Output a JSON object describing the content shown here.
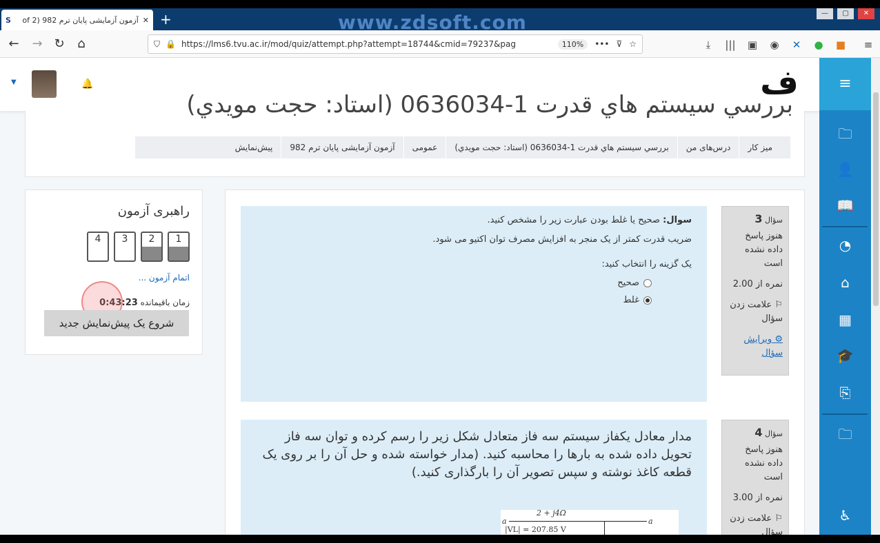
{
  "browser": {
    "tab_title": "آزمون آزمایشی پایان ترم 982 (2 of",
    "watermark": "www.zdsoft.com",
    "url": "https://lms6.tvu.ac.ir/mod/quiz/attempt.php?attempt=18744&cmid=79237&pag",
    "zoom": "110%"
  },
  "header": {
    "course_title": "بررسي سيستم هاي قدرت 1-0636034 (استاد: حجت مويدي)"
  },
  "breadcrumb": [
    "میز کار",
    "درس‌های من",
    "بررسي سيستم هاي قدرت 1-0636034 (استاد: حجت مويدي)",
    "عمومی",
    "آزمون آزمایشی پایان ترم 982",
    "پیش‌نمایش"
  ],
  "quiz_nav": {
    "title": "راهبری آزمون",
    "buttons": [
      "1",
      "2",
      "3",
      "4"
    ],
    "finish": "اتمام آزمون ...",
    "timer_label": "زمان باقیمانده",
    "timer_value": "0:43:23",
    "preview_button": "شروع یک پیش‌نمایش جدید"
  },
  "question3": {
    "no_label": "سؤال",
    "no": "3",
    "status": "هنوز پاسخ داده نشده است",
    "mark": "نمره از 2.00",
    "flag": "علامت زدن سؤال",
    "edit": "ویرایش سؤال",
    "q_label": "سوال:",
    "q_text": "صحیح یا غلط بودن عبارت زیر را مشخص کنید.",
    "statement": "ضریب قدرت کمتر از یک منجر به افزایش مصرف توان اکتیو می شود.",
    "prompt": "یک گزینه را انتخاب کنید:",
    "options": [
      "صحیح",
      "غلط"
    ]
  },
  "question4": {
    "no_label": "سؤال",
    "no": "4",
    "status": "هنوز پاسخ داده نشده است",
    "mark": "نمره از 3.00",
    "flag": "علامت زدن سؤال",
    "text": "مدار معادل یکفاز سیستم سه فاز متعادل شکل زیر را رسم کرده و توان سه فاز تحویل داده شده به بارها را محاسبه کنید. (مدار خواسته شده و حل آن را بر روی یک قطعه کاغذ نوشته و سپس تصویر آن را بارگذاری کنید.)",
    "fig_impedance": "2 + j4Ω",
    "fig_voltage": "|VL| = 207.85 V",
    "fig_node": "a"
  }
}
